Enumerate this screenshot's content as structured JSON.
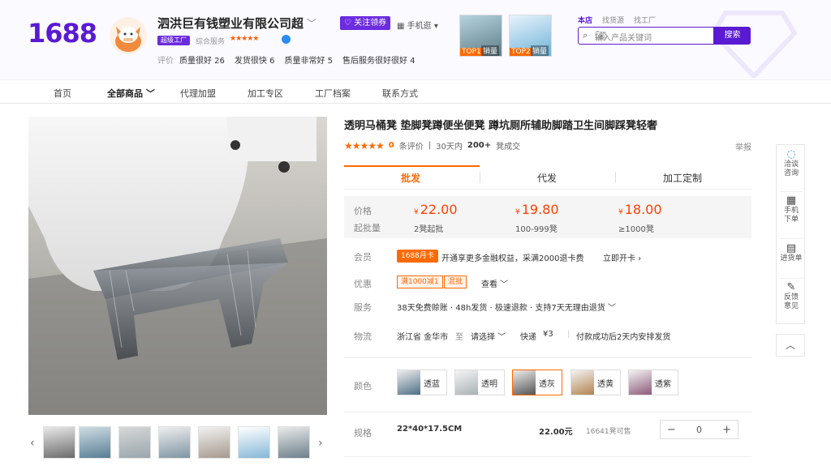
{
  "header": {
    "logo": "1688",
    "shop_name": "泗洪巨有钱塑业有限公司超",
    "factory_badge": "超级工厂",
    "service_label": "综合服务",
    "service_stars": "★★★★★",
    "eval_label": "评价",
    "eval_items": [
      "质量很好 26",
      "发货很快 6",
      "质量非常好 5",
      "售后服务很好很好 4"
    ],
    "follow_btn": "关注领券",
    "mobile": "手机逛",
    "top_thumbs": [
      {
        "badge": "TOP1",
        "text": "销量"
      },
      {
        "badge": "TOP2",
        "text": "销量"
      }
    ],
    "search_tabs": [
      "本店",
      "找货源",
      "找工厂"
    ],
    "search_placeholder": "输入产品关键词",
    "search_btn": "搜索"
  },
  "nav": {
    "items": [
      "首页",
      "全部商品",
      "代理加盟",
      "加工专区",
      "工厂档案",
      "联系方式"
    ]
  },
  "product": {
    "title": "透明马桶凳 垫脚凳蹲便坐便凳 蹲坑厕所辅助脚踏卫生间脚踩凳轻奢",
    "stars": "★★★★★",
    "review_count": "0",
    "review_label": "条评价",
    "sales_period": "30天内",
    "sales_count": "200+",
    "sales_unit": "凳成交",
    "report": "举报"
  },
  "tabs": [
    "批发",
    "代发",
    "加工定制"
  ],
  "prices": {
    "price_label": "价格",
    "moq_label": "起批量",
    "currency": "¥",
    "tiers": [
      {
        "price": "22.00",
        "qty": "2凳起批"
      },
      {
        "price": "19.80",
        "qty": "100-999凳"
      },
      {
        "price": "18.00",
        "qty": "≥1000凳"
      }
    ]
  },
  "member": {
    "label": "会员",
    "tag": "1688月卡",
    "text": "开通享更多金融权益，采满2000退卡费",
    "link": "立即开卡"
  },
  "discount": {
    "label": "优惠",
    "tags": [
      "满1000减1",
      "混批"
    ],
    "link": "查看"
  },
  "service": {
    "label": "服务",
    "text": "38天免费赊账 · 48h发货 · 极速退款 · 支持7天无理由退货"
  },
  "logistics": {
    "label": "物流",
    "from": "浙江省 金华市",
    "to_label": "至",
    "to": "请选择",
    "express": "快递",
    "fee": "¥3",
    "note": "付款成功后2天内安排发货"
  },
  "colors": {
    "label": "颜色",
    "options": [
      "透蓝",
      "透明",
      "透灰",
      "透黄",
      "透紫"
    ]
  },
  "spec": {
    "label": "规格",
    "value": "22*40*17.5CM",
    "price": "22.00元",
    "stock": "16641凳可售",
    "qty": "0"
  },
  "side": [
    "洽谈\n咨询",
    "手机\n下单",
    "进货单",
    "反馈\n意见"
  ],
  "colors_hex": {
    "brand": "#5a1ad4",
    "accent": "#ff6a00"
  }
}
